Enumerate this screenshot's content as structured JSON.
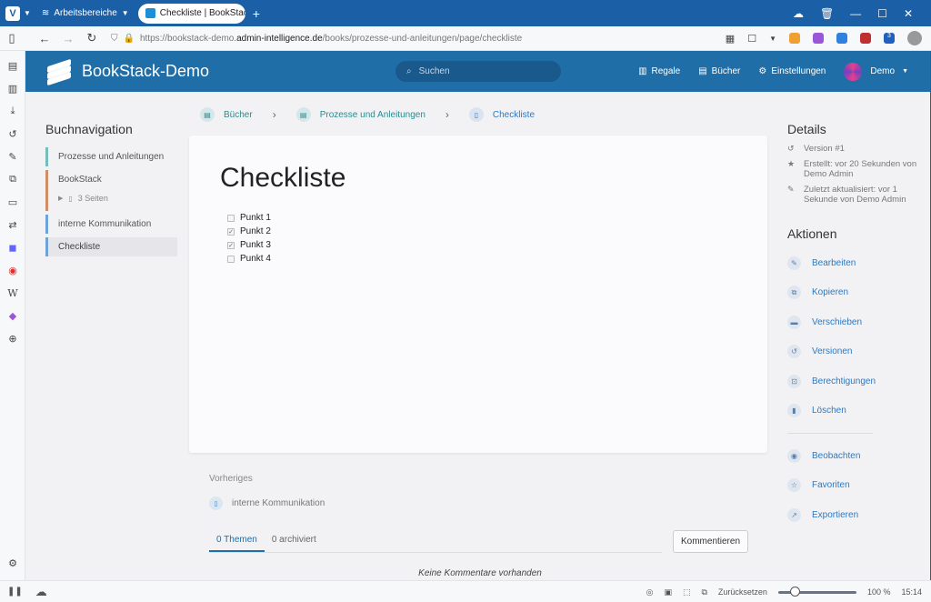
{
  "browser": {
    "workspaces_label": "Arbeitsbereiche",
    "tab_title": "Checkliste | BookStack-Demo",
    "url_scheme": "https://",
    "url_prefix": "bookstack-demo.",
    "url_host": "admin-intelligence.de",
    "url_path": "/books/prozesse-und-anleitungen/page/checkliste",
    "extension_badge": "3"
  },
  "statusbar": {
    "reset_label": "Zurücksetzen",
    "zoom": "100 %",
    "zoom_level": 1.0,
    "time": "15:14"
  },
  "header": {
    "app_name": "BookStack-Demo",
    "search_placeholder": "Suchen",
    "links": {
      "shelves": "Regale",
      "books": "Bücher",
      "settings": "Einstellungen",
      "user": "Demo"
    }
  },
  "breadcrumb": {
    "books": "Bücher",
    "book": "Prozesse und Anleitungen",
    "page": "Checkliste"
  },
  "book_nav": {
    "heading": "Buchnavigation",
    "items": [
      {
        "label": "Prozesse und Anleitungen"
      },
      {
        "label": "BookStack",
        "sub": "3 Seiten"
      },
      {
        "label": "interne Kommunikation"
      },
      {
        "label": "Checkliste"
      }
    ]
  },
  "page": {
    "title": "Checkliste",
    "checklist": [
      {
        "label": "Punkt 1",
        "checked": false
      },
      {
        "label": "Punkt 2",
        "checked": true
      },
      {
        "label": "Punkt 3",
        "checked": true
      },
      {
        "label": "Punkt 4",
        "checked": false
      }
    ]
  },
  "previous": {
    "label": "Vorheriges",
    "link": "interne Kommunikation"
  },
  "comments": {
    "tab_topics": "0 Themen",
    "tab_archived": "0 archiviert",
    "button": "Kommentieren",
    "empty": "Keine Kommentare vorhanden"
  },
  "details": {
    "heading": "Details",
    "version": "Version #1",
    "created": "Erstellt: vor 20 Sekunden von Demo Admin",
    "updated": "Zuletzt aktualisiert: vor 1 Sekunde von Demo Admin"
  },
  "actions": {
    "heading": "Aktionen",
    "edit": "Bearbeiten",
    "copy": "Kopieren",
    "move": "Verschieben",
    "revisions": "Versionen",
    "permissions": "Berechtigungen",
    "delete": "Löschen",
    "watch": "Beobachten",
    "favourites": "Favoriten",
    "export": "Exportieren"
  }
}
